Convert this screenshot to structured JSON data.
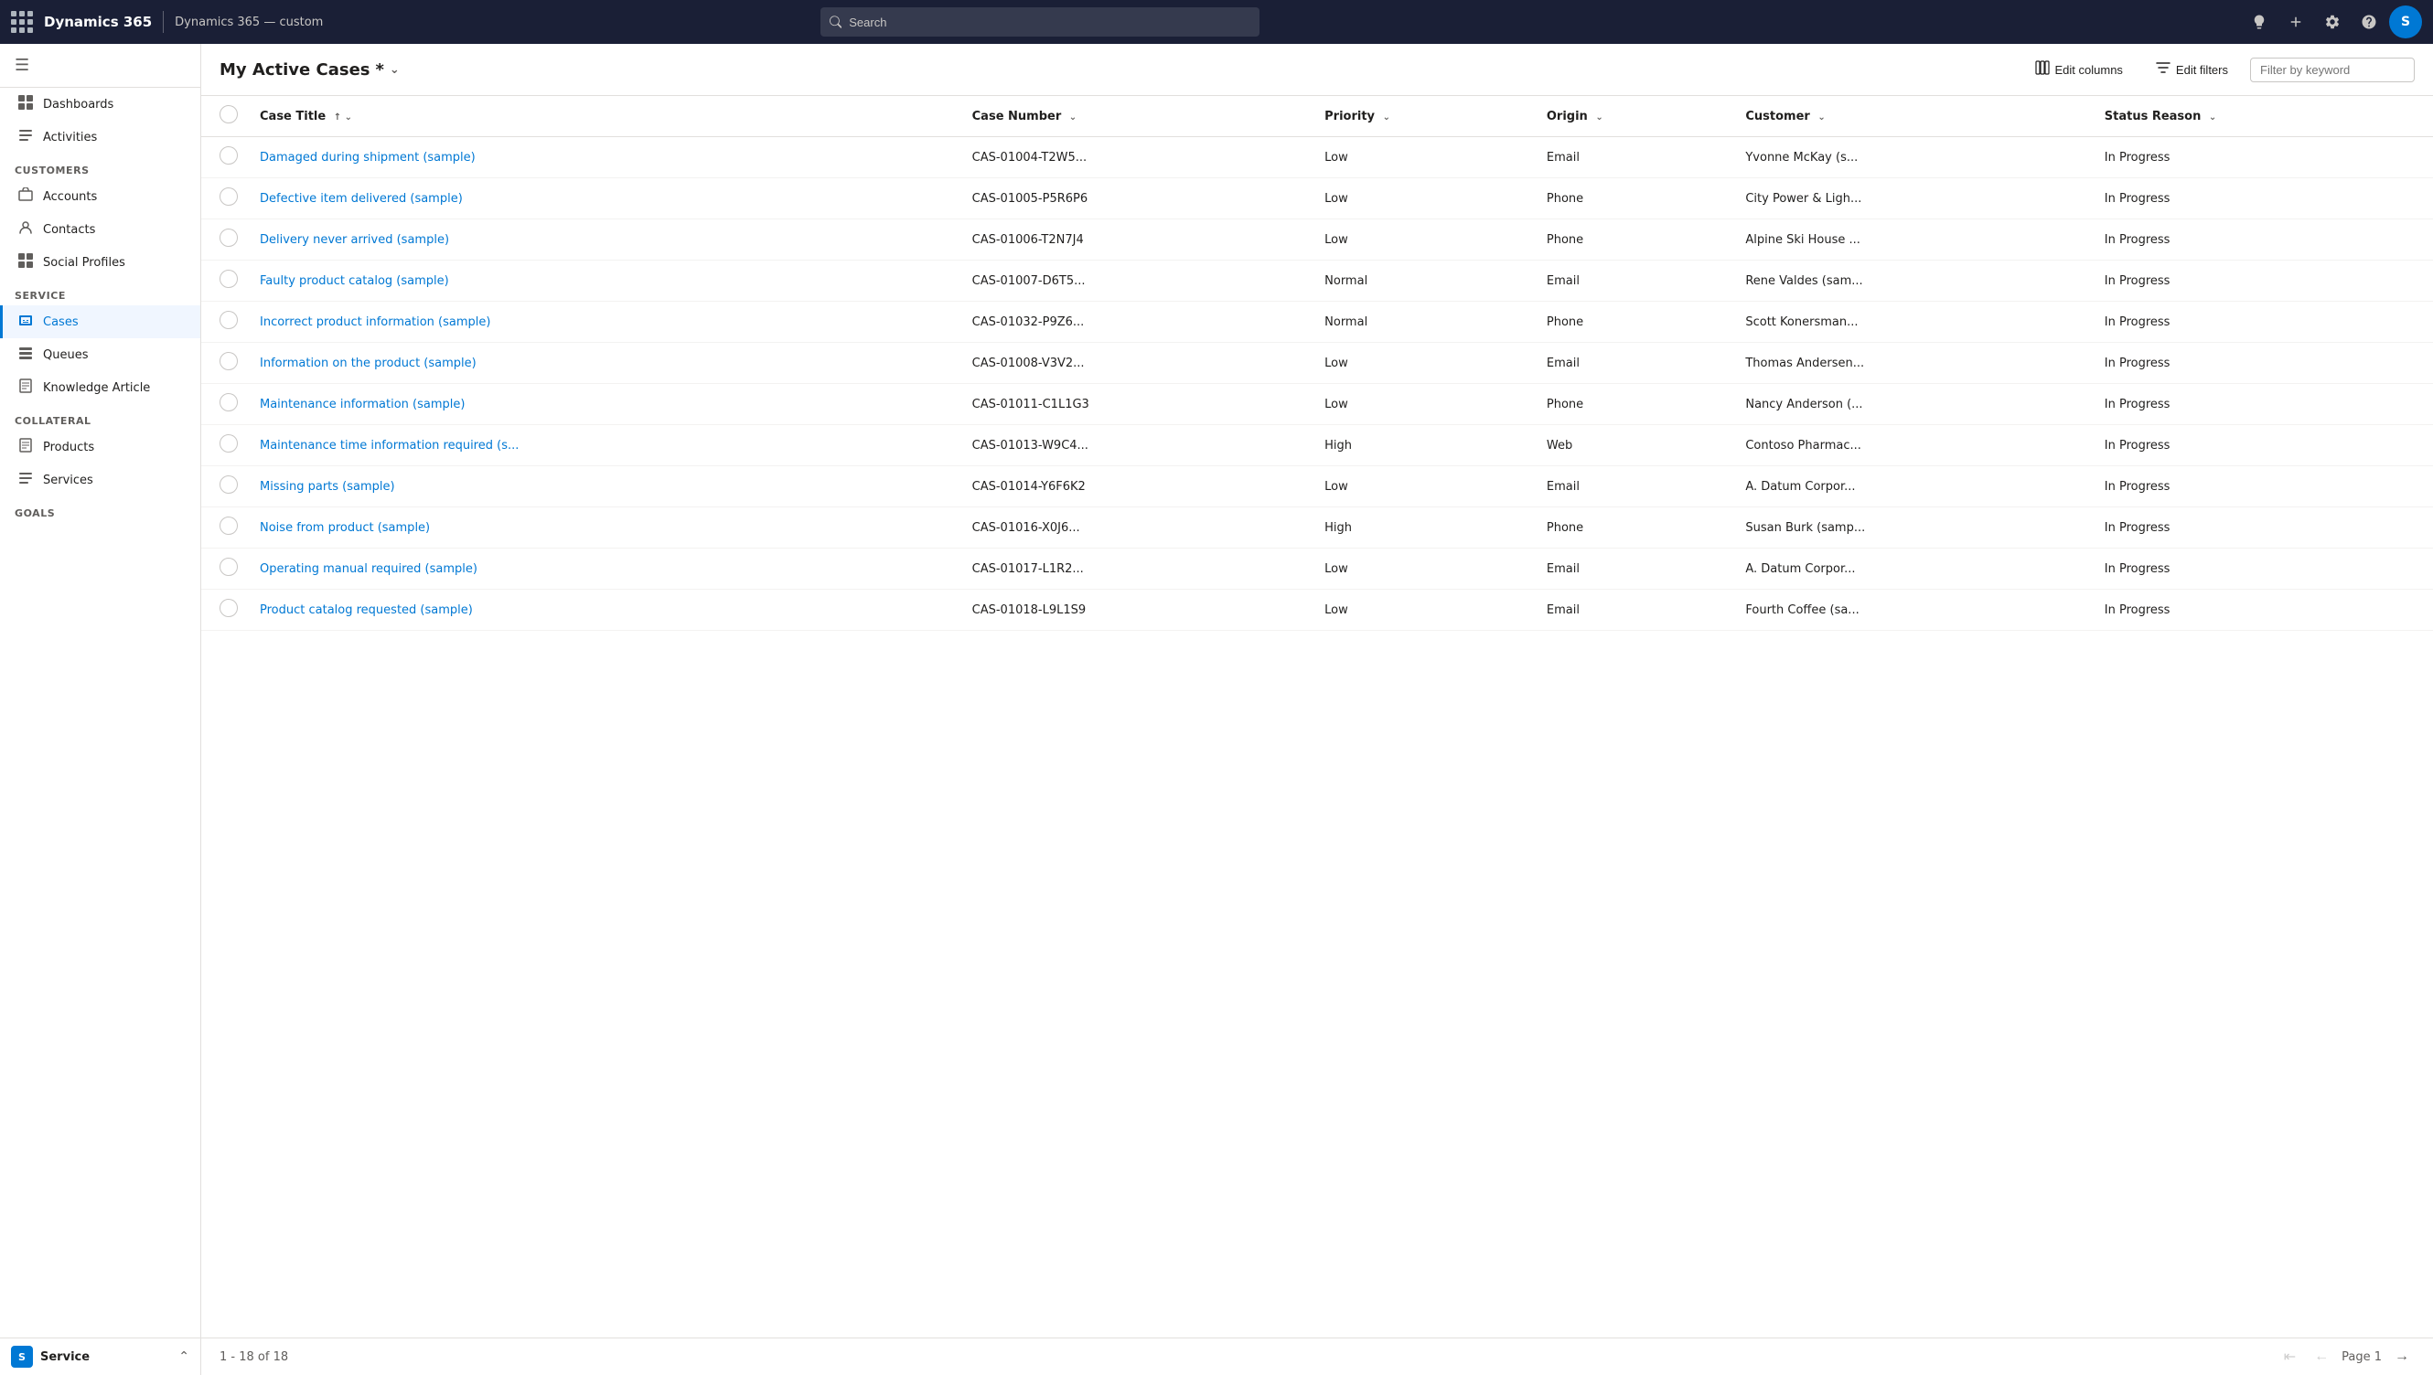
{
  "topnav": {
    "brand": "Dynamics 365",
    "divider": "|",
    "appname": "Dynamics 365 — custom",
    "search_placeholder": "Search",
    "icons": {
      "lightbulb": "💡",
      "plus": "+",
      "gear": "⚙",
      "question": "?",
      "avatar_initials": "S"
    }
  },
  "sidebar": {
    "hamburger": "☰",
    "top_items": [
      {
        "id": "dashboards",
        "label": "Dashboards",
        "icon": "⊞"
      },
      {
        "id": "activities",
        "label": "Activities",
        "icon": "📋"
      }
    ],
    "sections": [
      {
        "label": "Customers",
        "items": [
          {
            "id": "accounts",
            "label": "Accounts",
            "icon": "🏢"
          },
          {
            "id": "contacts",
            "label": "Contacts",
            "icon": "👤"
          },
          {
            "id": "social-profiles",
            "label": "Social Profiles",
            "icon": "⊞"
          }
        ]
      },
      {
        "label": "Service",
        "items": [
          {
            "id": "cases",
            "label": "Cases",
            "icon": "🔧",
            "active": true
          },
          {
            "id": "queues",
            "label": "Queues",
            "icon": "⊟"
          },
          {
            "id": "knowledge-article",
            "label": "Knowledge Article",
            "icon": "📄"
          }
        ]
      },
      {
        "label": "Collateral",
        "items": [
          {
            "id": "products",
            "label": "Products",
            "icon": "📦"
          },
          {
            "id": "services",
            "label": "Services",
            "icon": "📋"
          }
        ]
      },
      {
        "label": "Goals",
        "items": []
      }
    ],
    "footer": {
      "avatar_letter": "S",
      "label": "Service",
      "chevron": "⌃"
    }
  },
  "view": {
    "title": "My Active Cases",
    "asterisk": "*",
    "dropdown_icon": "▾",
    "edit_columns_label": "Edit columns",
    "edit_filters_label": "Edit filters",
    "filter_placeholder": "Filter by keyword",
    "columns": [
      {
        "id": "case-title",
        "label": "Case Title",
        "sort": "↑",
        "has_dropdown": true
      },
      {
        "id": "case-number",
        "label": "Case Number",
        "sort": "↓"
      },
      {
        "id": "priority",
        "label": "Priority",
        "sort": "↓"
      },
      {
        "id": "origin",
        "label": "Origin",
        "sort": "↓"
      },
      {
        "id": "customer",
        "label": "Customer",
        "sort": "↓"
      },
      {
        "id": "status-reason",
        "label": "Status Reason",
        "sort": "↓"
      }
    ],
    "rows": [
      {
        "case_title": "Damaged during shipment (sample)",
        "case_number": "CAS-01004-T2W5...",
        "priority": "Low",
        "origin": "Email",
        "customer": "Yvonne McKay (s...",
        "status": "In Progress"
      },
      {
        "case_title": "Defective item delivered (sample)",
        "case_number": "CAS-01005-P5R6P6",
        "priority": "Low",
        "origin": "Phone",
        "customer": "City Power & Ligh...",
        "status": "In Progress"
      },
      {
        "case_title": "Delivery never arrived (sample)",
        "case_number": "CAS-01006-T2N7J4",
        "priority": "Low",
        "origin": "Phone",
        "customer": "Alpine Ski House ...",
        "status": "In Progress"
      },
      {
        "case_title": "Faulty product catalog (sample)",
        "case_number": "CAS-01007-D6T5...",
        "priority": "Normal",
        "origin": "Email",
        "customer": "Rene Valdes (sam...",
        "status": "In Progress"
      },
      {
        "case_title": "Incorrect product information (sample)",
        "case_number": "CAS-01032-P9Z6...",
        "priority": "Normal",
        "origin": "Phone",
        "customer": "Scott Konersman...",
        "status": "In Progress"
      },
      {
        "case_title": "Information on the product (sample)",
        "case_number": "CAS-01008-V3V2...",
        "priority": "Low",
        "origin": "Email",
        "customer": "Thomas Andersen...",
        "status": "In Progress"
      },
      {
        "case_title": "Maintenance information (sample)",
        "case_number": "CAS-01011-C1L1G3",
        "priority": "Low",
        "origin": "Phone",
        "customer": "Nancy Anderson (...",
        "status": "In Progress"
      },
      {
        "case_title": "Maintenance time information required (s...",
        "case_number": "CAS-01013-W9C4...",
        "priority": "High",
        "origin": "Web",
        "customer": "Contoso Pharmac...",
        "status": "In Progress"
      },
      {
        "case_title": "Missing parts (sample)",
        "case_number": "CAS-01014-Y6F6K2",
        "priority": "Low",
        "origin": "Email",
        "customer": "A. Datum Corpor...",
        "status": "In Progress"
      },
      {
        "case_title": "Noise from product (sample)",
        "case_number": "CAS-01016-X0J6...",
        "priority": "High",
        "origin": "Phone",
        "customer": "Susan Burk (samp...",
        "status": "In Progress"
      },
      {
        "case_title": "Operating manual required (sample)",
        "case_number": "CAS-01017-L1R2...",
        "priority": "Low",
        "origin": "Email",
        "customer": "A. Datum Corpor...",
        "status": "In Progress"
      },
      {
        "case_title": "Product catalog requested (sample)",
        "case_number": "CAS-01018-L9L1S9",
        "priority": "Low",
        "origin": "Email",
        "customer": "Fourth Coffee (sa...",
        "status": "In Progress"
      }
    ],
    "pagination": {
      "info": "1 - 18 of 18",
      "page_label": "Page 1"
    }
  }
}
